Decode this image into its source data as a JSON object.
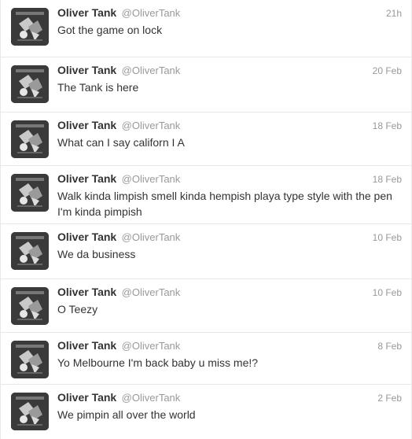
{
  "colors": {
    "border": "#e8e8e8",
    "name": "#333333",
    "muted": "#999999",
    "avatar_bg": "#3a3a3a"
  },
  "avatar_icon": "album-art-avatar",
  "tweets": [
    {
      "name": "Oliver Tank",
      "handle": "@OliverTank",
      "time": "21h",
      "text": "Got the game on lock"
    },
    {
      "name": "Oliver Tank",
      "handle": "@OliverTank",
      "time": "20 Feb",
      "text": "The Tank is here"
    },
    {
      "name": "Oliver Tank",
      "handle": "@OliverTank",
      "time": "18 Feb",
      "text": "What can I say californ I A"
    },
    {
      "name": "Oliver Tank",
      "handle": "@OliverTank",
      "time": "18 Feb",
      "text": "Walk kinda limpish smell kinda hempish playa type style with the pen I'm kinda pimpish"
    },
    {
      "name": "Oliver Tank",
      "handle": "@OliverTank",
      "time": "10 Feb",
      "text": "We da business"
    },
    {
      "name": "Oliver Tank",
      "handle": "@OliverTank",
      "time": "10 Feb",
      "text": "O Teezy"
    },
    {
      "name": "Oliver Tank",
      "handle": "@OliverTank",
      "time": "8 Feb",
      "text": "Yo Melbourne I'm back baby u miss me!?"
    },
    {
      "name": "Oliver Tank",
      "handle": "@OliverTank",
      "time": "2 Feb",
      "text": "We pimpin all over the world"
    }
  ]
}
